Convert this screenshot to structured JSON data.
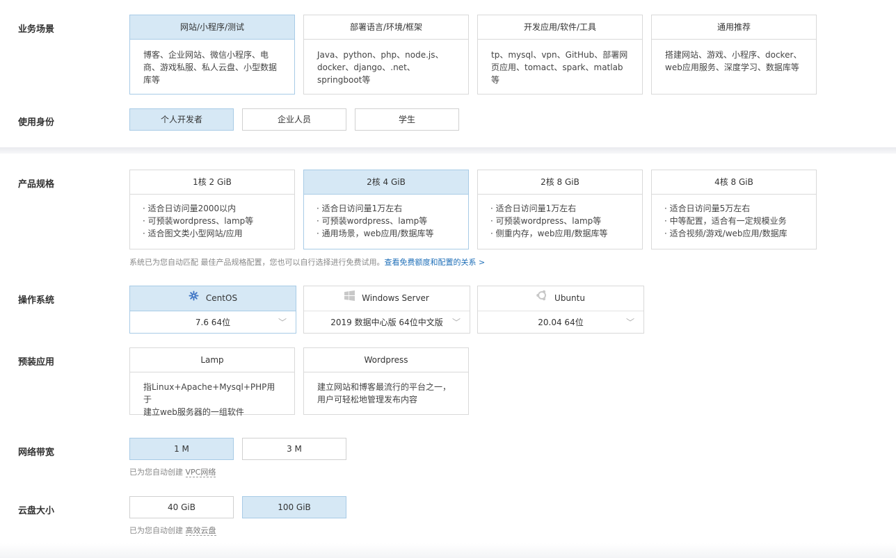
{
  "scenario": {
    "label": "业务场景",
    "cards": [
      {
        "title": "网站/小程序/测试",
        "desc": "博客、企业网站、微信小程序、电商、游戏私服、私人云盘、小型数据库等",
        "lines": [
          "博客、企业网站、微信小程序、电",
          "商、游戏私服、私人云盘、小型数据",
          "库等"
        ],
        "selected": true
      },
      {
        "title": "部署语言/环境/框架",
        "lines": [
          "Java、python、php、node.js、",
          "docker、django、.net、",
          "springboot等"
        ],
        "selected": false
      },
      {
        "title": "开发应用/软件/工具",
        "lines": [
          "tp、mysql、vpn、GitHub、部署网",
          "页应用、tomact、spark、matlab等"
        ],
        "selected": false
      },
      {
        "title": "通用推荐",
        "lines": [
          "搭建网站、游戏、小程序、docker、",
          "web应用服务、深度学习、数据库等"
        ],
        "selected": false
      }
    ]
  },
  "identity": {
    "label": "使用身份",
    "options": [
      "个人开发者",
      "企业人员",
      "学生"
    ],
    "selected_index": 0
  },
  "spec": {
    "label": "产品规格",
    "cards": [
      {
        "title": "1核 2 GiB",
        "bullets": [
          "· 适合日访问量2000以内",
          "· 可预装wordpress、lamp等",
          "· 适合图文类小型网站/应用"
        ]
      },
      {
        "title": "2核 4 GiB",
        "bullets": [
          "· 适合日访问量1万左右",
          "· 可预装wordpress、lamp等",
          "· 通用场景，web应用/数据库等"
        ]
      },
      {
        "title": "2核 8 GiB",
        "bullets": [
          "· 适合日访问量1万左右",
          "· 可预装wordpress、lamp等",
          "· 侧重内存，web应用/数据库等"
        ]
      },
      {
        "title": "4核 8 GiB",
        "bullets": [
          "· 适合日访问量5万左右",
          "· 中等配置，适合有一定规模业务",
          "· 适合视频/游戏/web应用/数据库"
        ]
      }
    ],
    "selected_index": 1,
    "hint": "系统已为您自动匹配 最佳产品规格配置，您也可以自行选择进行免费试用。",
    "hint_link": "查看免费额度和配置的关系 >"
  },
  "os": {
    "label": "操作系统",
    "options": [
      {
        "name": "CentOS",
        "version": "7.6 64位",
        "icon": "centos-icon"
      },
      {
        "name": "Windows Server",
        "version": "2019 数据中心版 64位中文版",
        "icon": "windows-icon"
      },
      {
        "name": "Ubuntu",
        "version": "20.04 64位",
        "icon": "ubuntu-icon"
      }
    ],
    "selected_index": 0
  },
  "apps": {
    "label": "预装应用",
    "cards": [
      {
        "title": "Lamp",
        "lines": [
          "指Linux+Apache+Mysql+PHP用于",
          "建立web服务器的一组软件"
        ]
      },
      {
        "title": "Wordpress",
        "lines": [
          "建立网站和博客最流行的平台之一，",
          "用户可轻松地管理发布内容"
        ]
      }
    ]
  },
  "bandwidth": {
    "label": "网络带宽",
    "options": [
      "1 M",
      "3 M"
    ],
    "selected_index": 0,
    "hint": "已为您自动创建",
    "hint_link": "VPC网络"
  },
  "disk": {
    "label": "云盘大小",
    "options": [
      "40 GiB",
      "100 GiB"
    ],
    "selected_index": 1,
    "hint": "已为您自动创建",
    "hint_link": "高效云盘"
  },
  "colors": {
    "selected_bg": "#d6e8f5",
    "selected_border": "#a8cbe6",
    "link": "#1f6fb8",
    "centos_icon": "#3e75c4"
  }
}
